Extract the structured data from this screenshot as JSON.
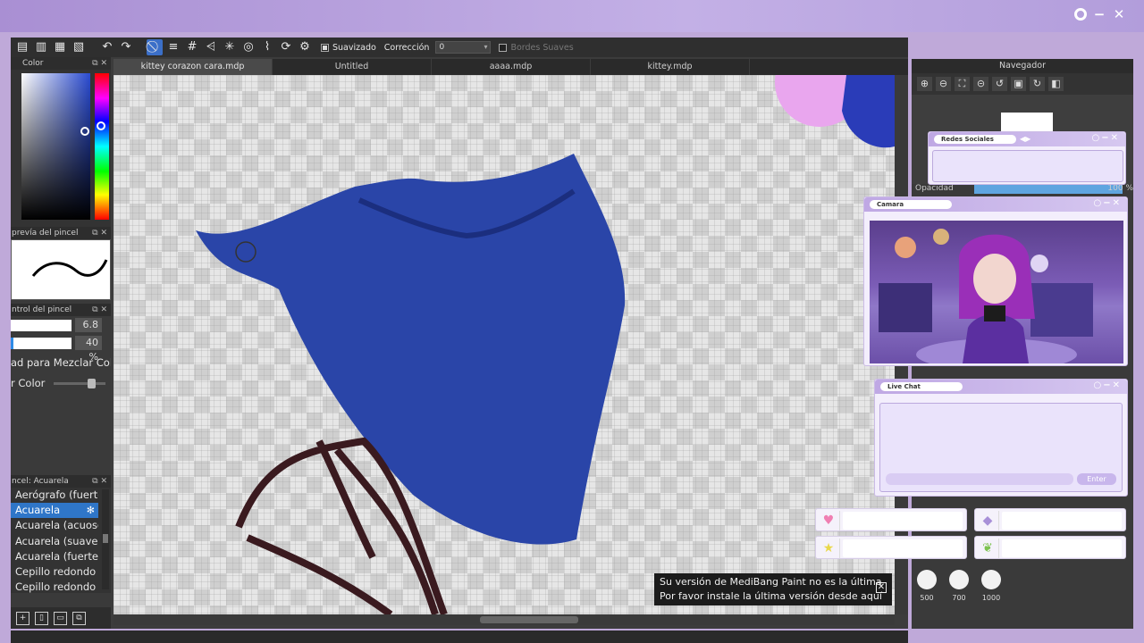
{
  "toolbar": {
    "smoothing_label": "Suavizado",
    "correction_label": "Corrección",
    "correction_value": "0",
    "soft_edges_label": "Bordes Suaves"
  },
  "tabs": [
    "kittey corazon cara.mdp",
    "Untitled",
    "aaaa.mdp",
    "kittey.mdp"
  ],
  "panels": {
    "color": {
      "title": "Color",
      "accent": "#2a4bd1"
    },
    "brush_preview": {
      "title": "prevía del pincel"
    },
    "brush_control": {
      "title": "ntrol del pincel",
      "size": "6.8",
      "opacity": "40 %",
      "opacity_fraction": 0.05,
      "mix_label": "ad para Mezclar Colo",
      "color_label": "r Color"
    },
    "brush_list": {
      "title": "ncel: Acuarela",
      "items": [
        "Aerógrafo (fuerte",
        "Acuarela",
        "Acuarela (acuoso)",
        "Acuarela (suave)",
        "Acuarela (fuerte)",
        "Cepillo redondo",
        "Cepillo redondo (a"
      ]
    }
  },
  "navigator": {
    "title": "Navegador",
    "opacity_label": "Opacidad",
    "opacity_value": "100 %"
  },
  "notice": {
    "line1": "Su versión de MediBang Paint no es la última",
    "line2": "Por favor instale la última versión desde aquí"
  },
  "overlay": {
    "social_title": "Redes Sociales",
    "camera_title": "Camara",
    "chat_title": "Live Chat",
    "enter_label": "Enter",
    "amounts": [
      "500",
      "700",
      "1000"
    ]
  },
  "colors": {
    "blue_shape": "#2a45a8",
    "overlay_lavender": "#c3b0e6",
    "selection": "#2f76c8"
  }
}
